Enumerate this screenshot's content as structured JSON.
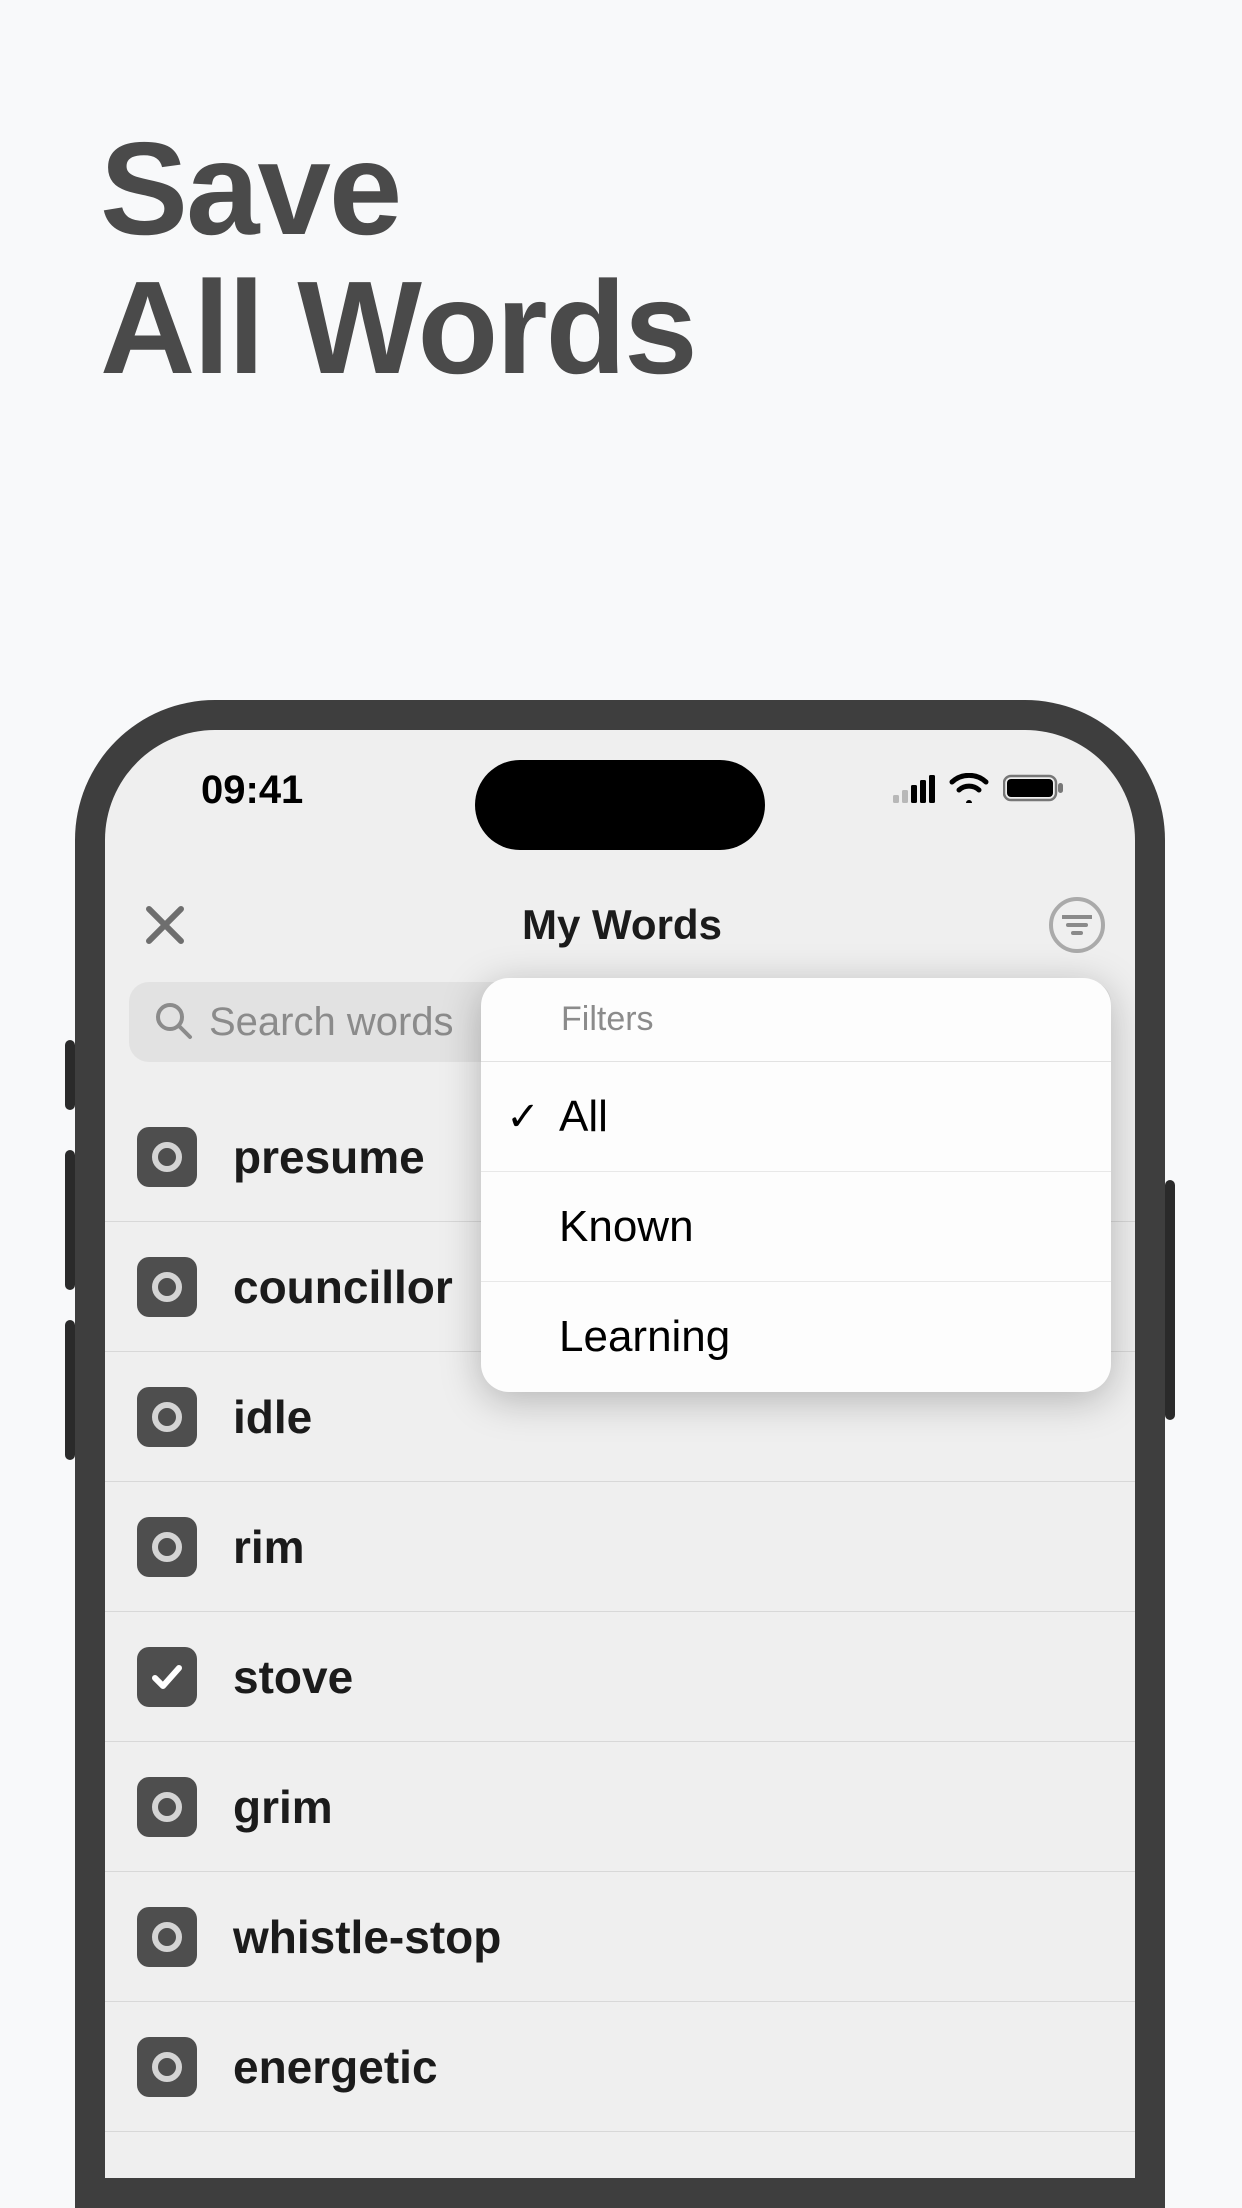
{
  "promo": {
    "line1": "Save",
    "line2": "All Words"
  },
  "status": {
    "time": "09:41"
  },
  "header": {
    "title": "My Words"
  },
  "search": {
    "placeholder": "Search words"
  },
  "words": [
    {
      "label": "presume",
      "checked": false
    },
    {
      "label": "councillor",
      "checked": false
    },
    {
      "label": "idle",
      "checked": false
    },
    {
      "label": "rim",
      "checked": false
    },
    {
      "label": "stove",
      "checked": true
    },
    {
      "label": "grim",
      "checked": false
    },
    {
      "label": "whistle-stop",
      "checked": false
    },
    {
      "label": "energetic",
      "checked": false
    }
  ],
  "filters": {
    "header": "Filters",
    "items": [
      {
        "label": "All",
        "selected": true
      },
      {
        "label": "Known",
        "selected": false
      },
      {
        "label": "Learning",
        "selected": false
      }
    ]
  }
}
